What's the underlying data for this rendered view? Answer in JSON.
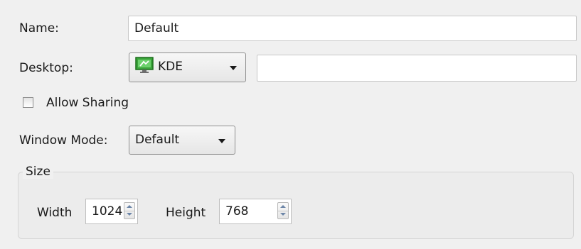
{
  "form": {
    "name": {
      "label": "Name:",
      "value": "Default"
    },
    "desktop": {
      "label": "Desktop:",
      "selected": "KDE",
      "icon": "kde-icon",
      "extra_value": ""
    },
    "allow_sharing": {
      "label": "Allow Sharing",
      "checked": false
    },
    "window_mode": {
      "label": "Window Mode:",
      "selected": "Default"
    },
    "size": {
      "title": "Size",
      "width": {
        "label": "Width",
        "value": "1024"
      },
      "height": {
        "label": "Height",
        "value": "768"
      }
    }
  },
  "colors": {
    "background": "#f0f0f0",
    "field_border": "#c7c7c7",
    "kde_icon_green": "#3aa33a"
  }
}
